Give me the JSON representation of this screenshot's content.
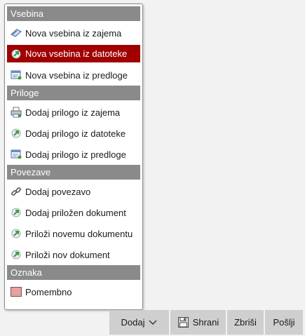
{
  "menu": {
    "sections": [
      {
        "title": "Vsebina",
        "items": [
          {
            "label": "Nova vsebina iz zajema",
            "icon": "scan-icon"
          },
          {
            "label": "Nova vsebina iz datoteke",
            "icon": "file-upload-icon",
            "selected": true
          },
          {
            "label": "Nova vsebina iz predloge",
            "icon": "template-icon"
          }
        ]
      },
      {
        "title": "Priloge",
        "items": [
          {
            "label": "Dodaj prilogo iz zajema",
            "icon": "scanner-icon"
          },
          {
            "label": "Dodaj prilogo iz datoteke",
            "icon": "file-upload-icon"
          },
          {
            "label": "Dodaj prilogo iz predloge",
            "icon": "template-icon"
          }
        ]
      },
      {
        "title": "Povezave",
        "items": [
          {
            "label": "Dodaj povezavo",
            "icon": "link-icon"
          },
          {
            "label": "Dodaj priložen dokument",
            "icon": "file-upload-icon"
          },
          {
            "label": "Priloži novemu dokumentu",
            "icon": "file-upload-icon"
          },
          {
            "label": "Priloži nov dokument",
            "icon": "file-upload-icon"
          }
        ]
      },
      {
        "title": "Oznaka",
        "items": [
          {
            "label": "Pomembno",
            "icon": "color-swatch-icon",
            "swatch_color": "#e8a0a0"
          }
        ]
      }
    ]
  },
  "toolbar": {
    "add_label": "Dodaj",
    "save_label": "Shrani",
    "delete_label": "Zbriši",
    "send_label": "Pošlji"
  },
  "colors": {
    "selected_bg": "#a00000",
    "section_header_bg": "#8a8a8a",
    "toolbar_button_bg": "#cfcfcf"
  }
}
